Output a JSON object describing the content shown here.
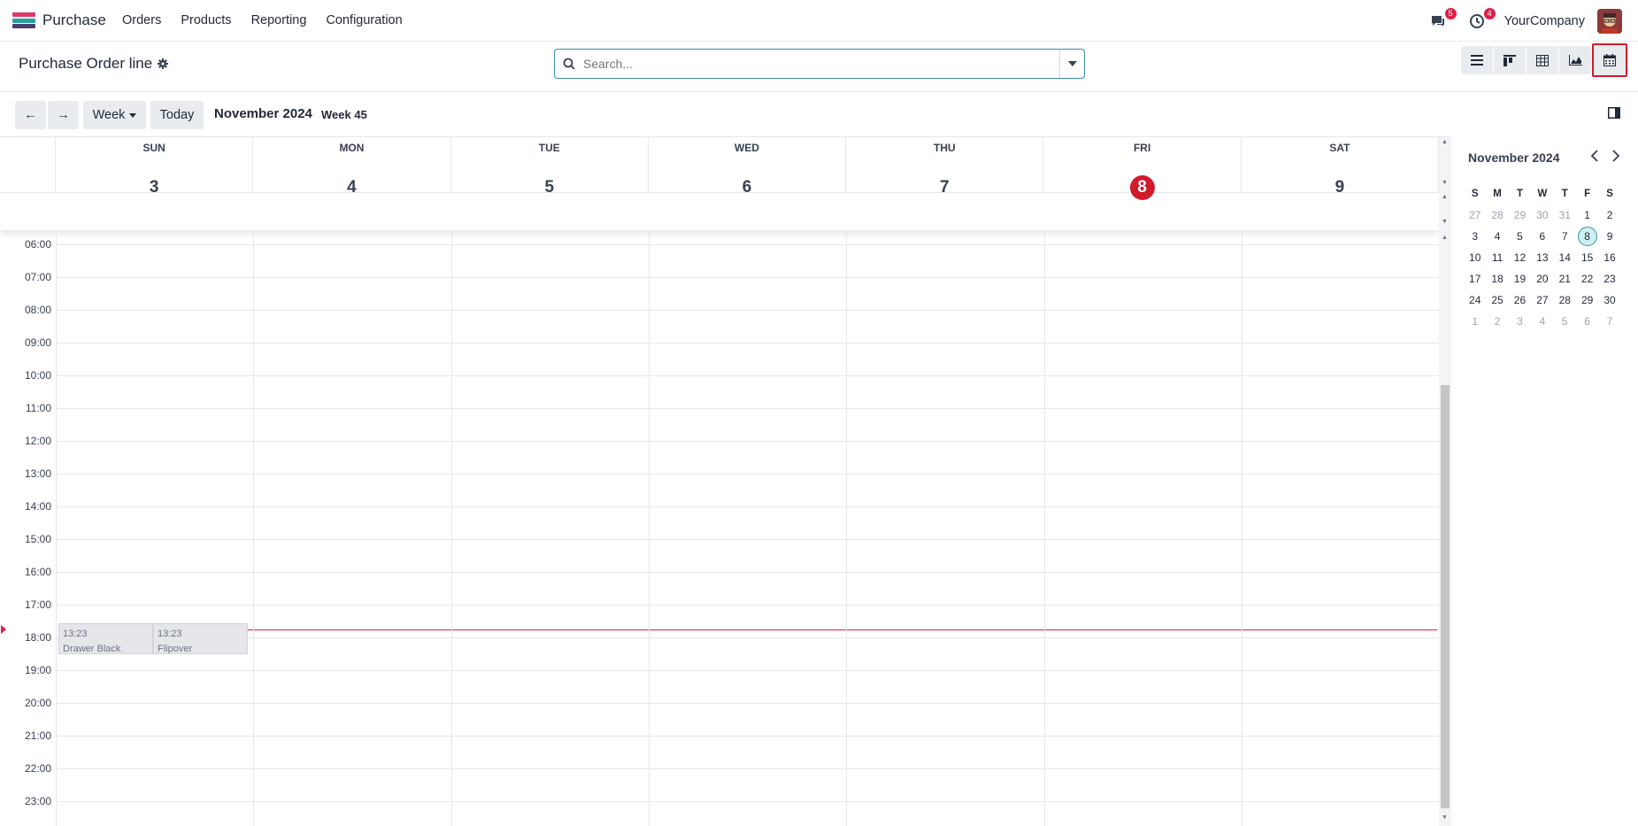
{
  "topbar": {
    "app_name": "Purchase",
    "menu": [
      "Orders",
      "Products",
      "Reporting",
      "Configuration"
    ],
    "messages_count": "5",
    "activities_count": "4",
    "company": "YourCompany",
    "colors": {
      "badge": "#e11d48",
      "logo": [
        "#e03a6a",
        "#2aa1a1",
        "#4a3f6b"
      ]
    }
  },
  "control": {
    "title": "Purchase Order line",
    "search_placeholder": "Search...",
    "views": [
      "list-icon",
      "kanban-icon",
      "pivot-icon",
      "graph-icon",
      "calendar-icon"
    ],
    "active_view": "calendar-icon"
  },
  "calendar": {
    "prev_label": "←",
    "next_label": "→",
    "scale_label": "Week",
    "today_label": "Today",
    "title": "November 2024",
    "week": "Week 45",
    "days": [
      {
        "name": "SUN",
        "num": "3"
      },
      {
        "name": "MON",
        "num": "4"
      },
      {
        "name": "TUE",
        "num": "5"
      },
      {
        "name": "WED",
        "num": "6"
      },
      {
        "name": "THU",
        "num": "7"
      },
      {
        "name": "FRI",
        "num": "8",
        "today": true
      },
      {
        "name": "SAT",
        "num": "9"
      }
    ],
    "hours": [
      "06:00",
      "07:00",
      "08:00",
      "09:00",
      "10:00",
      "11:00",
      "12:00",
      "13:00",
      "14:00",
      "15:00",
      "16:00",
      "17:00",
      "18:00",
      "19:00",
      "20:00",
      "21:00",
      "22:00",
      "23:00"
    ],
    "events": [
      {
        "time": "13:23",
        "title": "Drawer Black"
      },
      {
        "time": "13:23",
        "title": "Flipover"
      }
    ],
    "accent": "#d11a2a"
  },
  "mini_calendar": {
    "title": "November 2024",
    "weekdays": [
      "S",
      "M",
      "T",
      "W",
      "T",
      "F",
      "S"
    ],
    "weeks": [
      [
        "27",
        "28",
        "29",
        "30",
        "31",
        "1",
        "2"
      ],
      [
        "3",
        "4",
        "5",
        "6",
        "7",
        "8",
        "9"
      ],
      [
        "10",
        "11",
        "12",
        "13",
        "14",
        "15",
        "16"
      ],
      [
        "17",
        "18",
        "19",
        "20",
        "21",
        "22",
        "23"
      ],
      [
        "24",
        "25",
        "26",
        "27",
        "28",
        "29",
        "30"
      ],
      [
        "1",
        "2",
        "3",
        "4",
        "5",
        "6",
        "7"
      ]
    ],
    "selected": "8"
  }
}
